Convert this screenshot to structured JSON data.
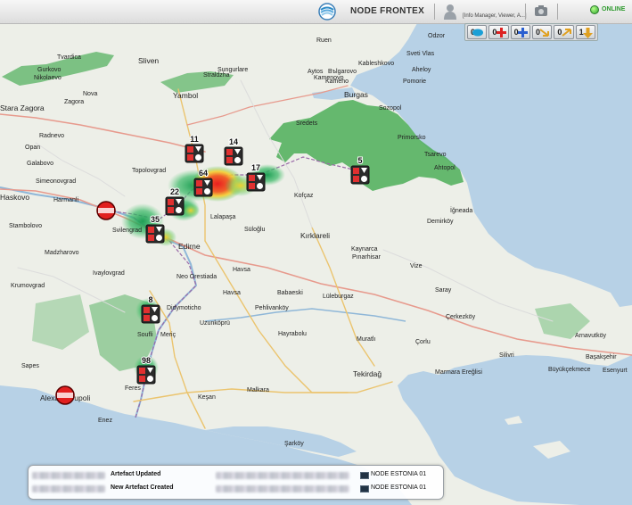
{
  "header": {
    "app_title": "NODE FRONTEX",
    "user_role": "[Info Manager, Viewer, A...]",
    "status": "ONLINE"
  },
  "toolbar": {
    "buttons": [
      {
        "count": "0",
        "icon": "layers-icon"
      },
      {
        "count": "0",
        "icon": "add-red-icon"
      },
      {
        "count": "0",
        "icon": "add-blue-icon"
      },
      {
        "count": "0",
        "icon": "arrow-down-icon"
      },
      {
        "count": "0",
        "icon": "arrow-up-icon"
      },
      {
        "count": "1",
        "icon": "download-icon"
      }
    ]
  },
  "map": {
    "places": [
      "Odzor",
      "Ruen",
      "Sungurlare",
      "Sveti Vlas",
      "Tvardica",
      "Aheloy",
      "Gurkovo",
      "Sliven",
      "Kableshkovo",
      "Pomorie",
      "Nikolaevo",
      "Kamenovo",
      "Aytos",
      "Bъlgarovo",
      "Kameno",
      "Nova",
      "Straldzha",
      "Burgas",
      "Zagora",
      "Yambol",
      "Sozopol",
      "Stara Zagora",
      "Radnevo",
      "Sredets",
      "Primorsko",
      "Tsarevo",
      "Ahtopol",
      "Opan",
      "Galabovo",
      "Topolovgrad",
      "Simeonovgrad",
      "Harmanli",
      "Haskovo",
      "Stambolovo",
      "Svilengrad",
      "Lalapaşa",
      "Süloğlu",
      "Kofçaz",
      "Kırklareli",
      "İğneada",
      "Demirköy",
      "Madzharovo",
      "Ivaylovgrad",
      "Edirne",
      "Kaynarca",
      "Pınarhisar",
      "Havsa",
      "Vize",
      "Krumovgrad",
      "Neo Orestiada",
      "Didymoticho",
      "Babaeski",
      "Lüleburgaz",
      "Saray",
      "Pehlivanköy",
      "Soufli",
      "Meriç",
      "Uzunköprü",
      "Hayrabolu",
      "Muratlı",
      "Çerkezköy",
      "Çorlu",
      "Silivri",
      "Marmara Ereğlisi",
      "Tekirdağ",
      "Feres",
      "Alexandroupoli",
      "Keşan",
      "Malkara",
      "Enez",
      "Şarköy",
      "Sapes",
      "Büyükçekmece",
      "Başakşehir",
      "Esenyurt",
      "Arnavutköy",
      "Havsa"
    ],
    "clusters": [
      {
        "count": "11"
      },
      {
        "count": "14"
      },
      {
        "count": "64"
      },
      {
        "count": "17"
      },
      {
        "count": "5"
      },
      {
        "count": "22"
      },
      {
        "count": "35"
      },
      {
        "count": "8"
      },
      {
        "count": "98"
      }
    ]
  },
  "feed": {
    "rows": [
      {
        "label": "Artefact Updated",
        "node": "NODE ESTONIA 01"
      },
      {
        "label": "New Artefact Created",
        "node": "NODE ESTONIA 01"
      }
    ]
  }
}
